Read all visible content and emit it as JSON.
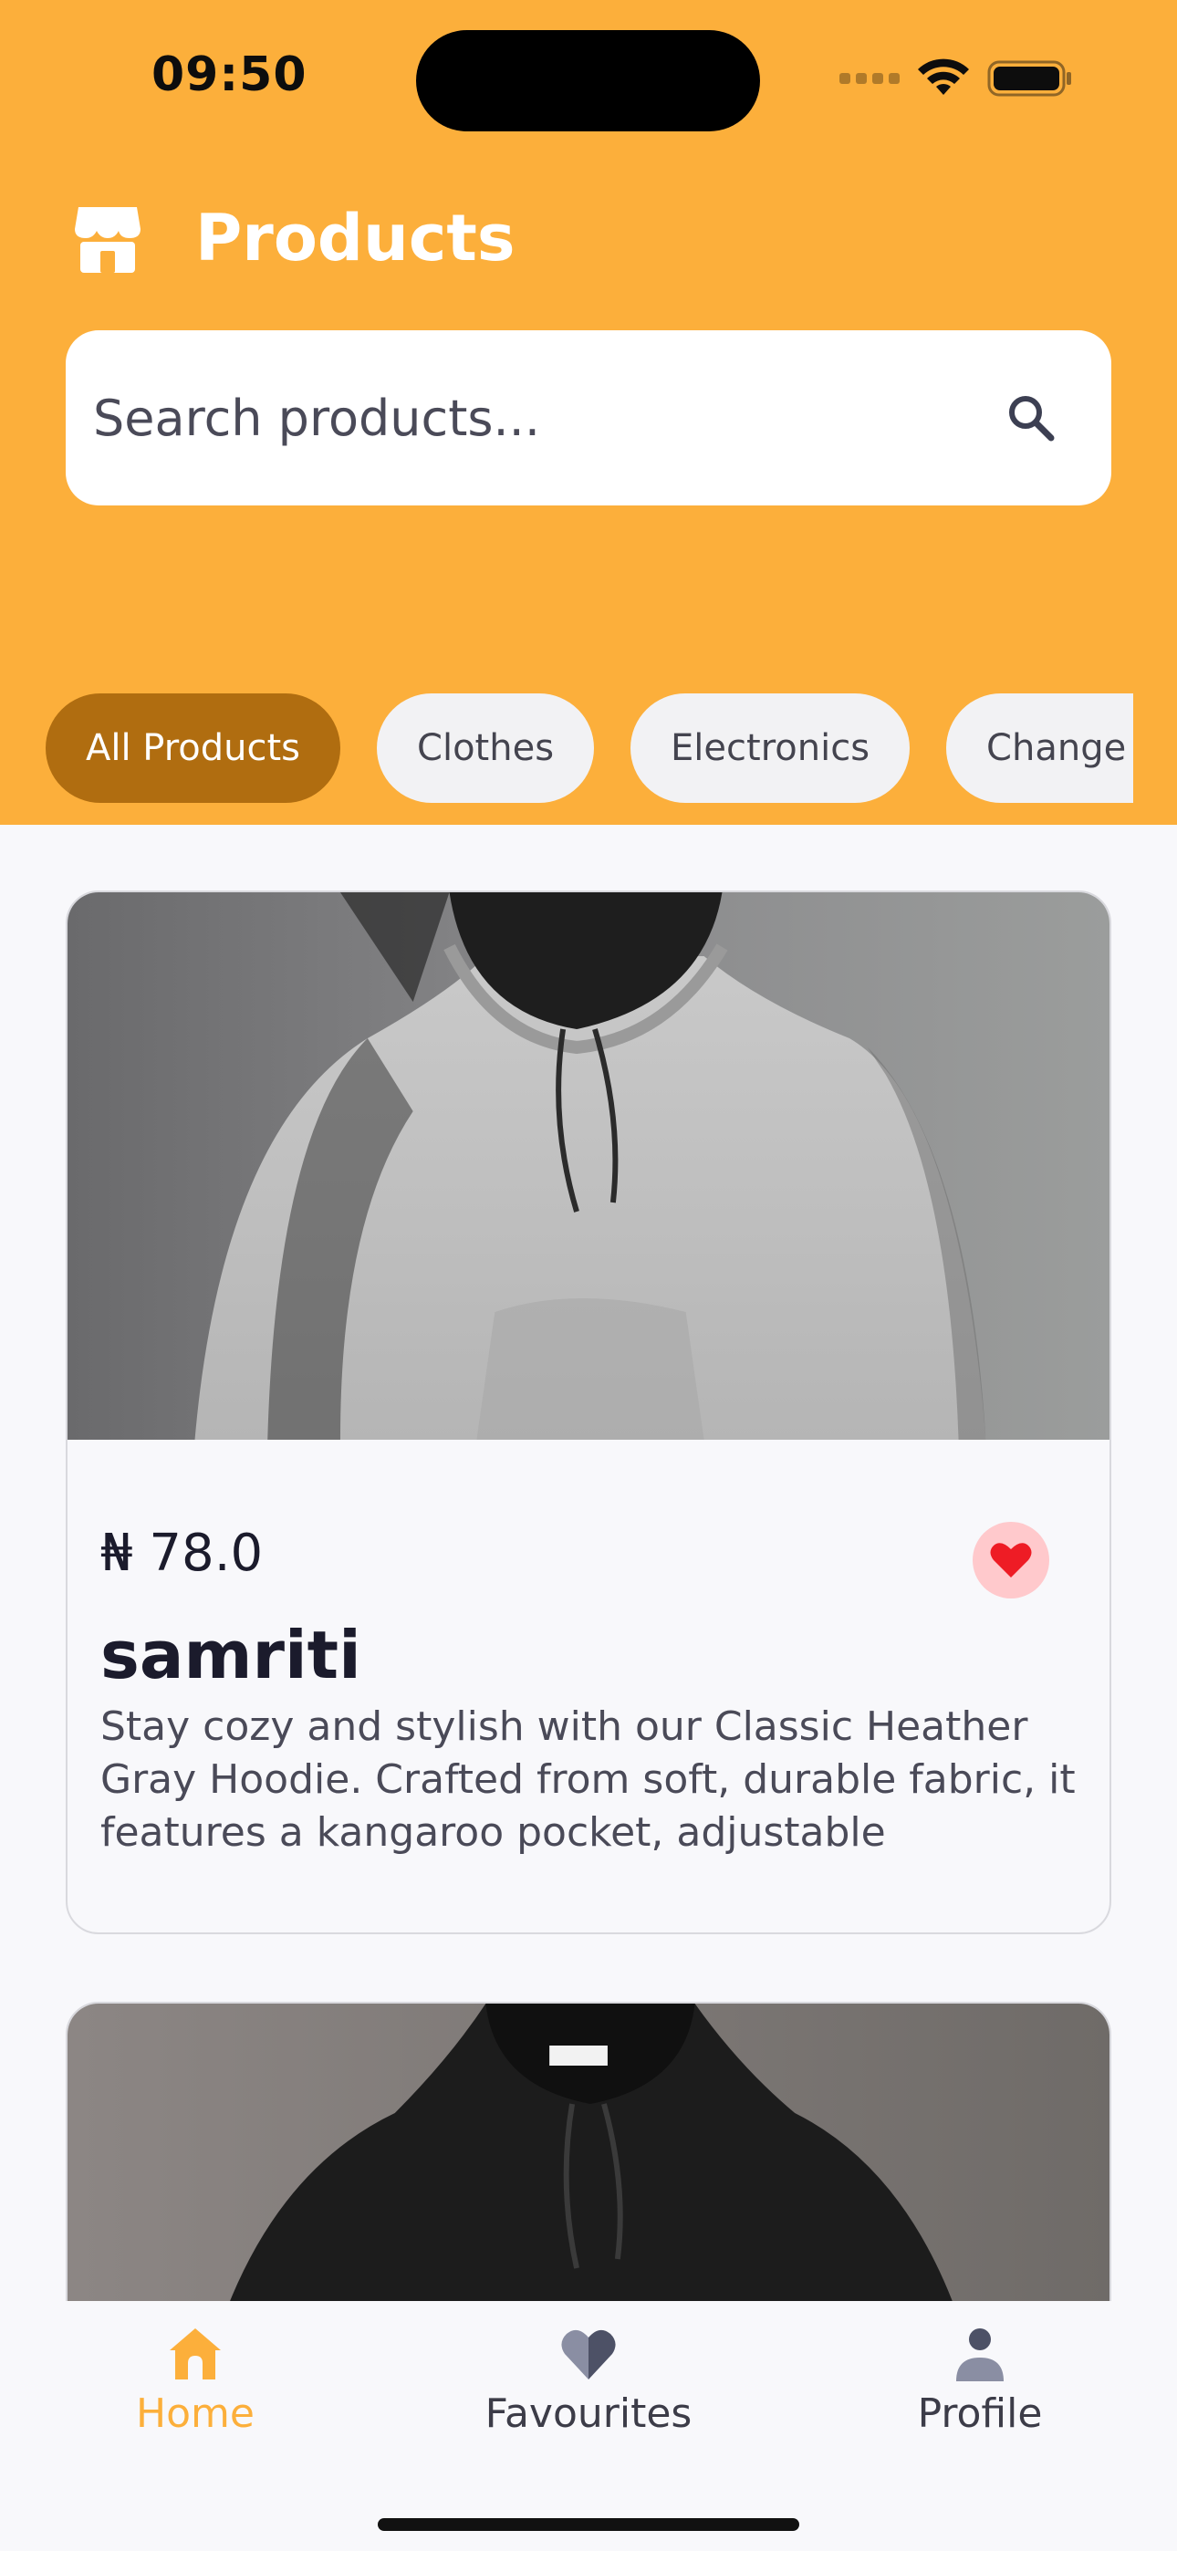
{
  "status_bar": {
    "time": "09:50"
  },
  "header": {
    "title": "Products",
    "icon": "store-icon",
    "bg_color": "#fcaf3b"
  },
  "search": {
    "placeholder": "Search products..."
  },
  "categories": {
    "items": [
      {
        "label": "All Products",
        "active": true
      },
      {
        "label": "Clothes",
        "active": false
      },
      {
        "label": "Electronics",
        "active": false
      },
      {
        "label": "Change ti",
        "active": false
      }
    ],
    "active_color": "#b06d10"
  },
  "products": [
    {
      "price": "₦ 78.0",
      "name": "samriti",
      "description": "Stay cozy and stylish with our Classic Heather Gray Hoodie. Crafted from soft, durable fabric, it features a kangaroo pocket, adjustable",
      "favourite": true,
      "image": "gray-hoodie-image"
    },
    {
      "image": "black-hoodie-image"
    }
  ],
  "bottom_nav": {
    "items": [
      {
        "label": "Home",
        "icon": "home-icon",
        "active": true
      },
      {
        "label": "Favourites",
        "icon": "heart-icon",
        "active": false
      },
      {
        "label": "Profile",
        "icon": "person-icon",
        "active": false
      }
    ]
  }
}
